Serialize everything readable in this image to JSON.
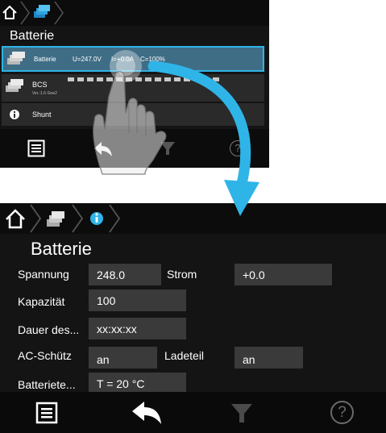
{
  "screen_top": {
    "title": "Batterie",
    "rows": {
      "battery": {
        "label": "Batterie",
        "voltage": "U=247.0V",
        "current": "I=+0.0A",
        "soc": "C=100%"
      },
      "bcs": {
        "label": "BCS",
        "version": "Ver.:1.6-Ssw2"
      },
      "shunt": {
        "label": "Shunt"
      }
    },
    "footer": {
      "help": "?"
    }
  },
  "screen_bottom": {
    "title": "Batterie",
    "fields": {
      "spannung_label": "Spannung",
      "spannung_value": "248.0",
      "strom_label": "Strom",
      "strom_value": "+0.0",
      "kapazitaet_label": "Kapazität",
      "kapazitaet_value": "100",
      "dauer_label": "Dauer des...",
      "dauer_value": "xx:xx:xx",
      "ac_label": "AC-Schütz",
      "ac_value": "an",
      "ladeteil_label": "Ladeteil",
      "ladeteil_value": "an",
      "batterie_temp_label": "Batteriete...",
      "batterie_temp_value": "T = 20 °C"
    },
    "footer": {
      "help": "?"
    }
  },
  "colors": {
    "accent": "#2fb4e8",
    "selected_row": "#3f6d86",
    "arrow": "#2fb4e8",
    "screen_bg": "#141414",
    "field_bg": "#3a3a3a"
  },
  "icons": {
    "home": "home-icon",
    "battery_stack": "battery-stack-icon",
    "info": "info-icon",
    "menu": "menu-icon",
    "back": "back-arrow-icon",
    "filter": "filter-icon",
    "help": "help-icon",
    "hand": "hand-pointer-icon",
    "arrow": "transition-arrow"
  }
}
